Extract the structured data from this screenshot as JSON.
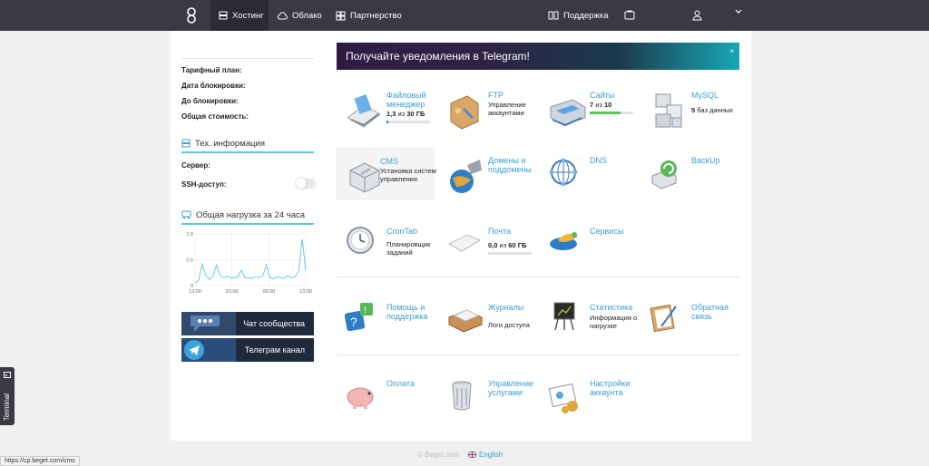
{
  "nav": {
    "hosting": "Хостинг",
    "cloud": "Облако",
    "partner": "Партнерство",
    "support": "Поддержка"
  },
  "sidebar": {
    "plan_label": "Тарифный план:",
    "block_date_label": "Дата блокировки:",
    "until_block_label": "До блокировки:",
    "total_cost_label": "Общая стоимость:",
    "tech_title": "Тех. информация",
    "server_label": "Сервер:",
    "ssh_label": "SSH-доступ:",
    "load_title": "Общая нагрузка за 24 часа",
    "chat_label": "Чат сообщества",
    "telegram_label": "Телеграм канал"
  },
  "chart_data": {
    "type": "line",
    "title": "Общая нагрузка за 24 часа",
    "x_ticks": [
      "13:00",
      "21:00",
      "05:00",
      "13:00"
    ],
    "y_ticks": [
      "1.0",
      "0.5",
      "0"
    ],
    "ylim": [
      0,
      1
    ],
    "series": [
      {
        "values": [
          0.05,
          0.1,
          0.42,
          0.2,
          0.12,
          0.18,
          0.4,
          0.2,
          0.15,
          0.18,
          0.15,
          0.15,
          0.17,
          0.3,
          0.15,
          0.15,
          0.14,
          0.17,
          0.15,
          0.2,
          0.4,
          0.15,
          0.13,
          0.17,
          0.15,
          0.14,
          0.2,
          0.15,
          0.17,
          0.28,
          0.9,
          0.3
        ],
        "color": "#6cc5ea"
      }
    ]
  },
  "banner": {
    "text": "Получайте уведомления в Telegram!",
    "close": "×"
  },
  "tiles": {
    "files": {
      "name": "Файловый менеджер",
      "used": "1,3",
      "of": "из",
      "total": "30 ГБ",
      "fill": 0.04
    },
    "ftp": {
      "name": "FTP",
      "sub": "Управление аккаунтами"
    },
    "sites": {
      "name": "Сайты",
      "used": "7",
      "of": "из",
      "total": "10",
      "fill": 0.7
    },
    "mysql": {
      "name": "MySQL",
      "count": "5",
      "sub": "баз данных"
    },
    "cms": {
      "name": "CMS",
      "sub": "Установка систем управления"
    },
    "domains": {
      "name": "Домены и поддомены"
    },
    "dns": {
      "name": "DNS"
    },
    "backup": {
      "name": "BackUp"
    },
    "crontab": {
      "name": "CronTab",
      "sub": "Планировщик заданий"
    },
    "mail": {
      "name": "Почта",
      "used": "0,0",
      "of": "из",
      "total": "60 ГБ",
      "fill": 0.0
    },
    "services": {
      "name": "Сервисы"
    },
    "help": {
      "name": "Помощь и поддержка"
    },
    "logs": {
      "name": "Журналы",
      "sub": "Логи доступа"
    },
    "stats": {
      "name": "Статистика",
      "sub": "Информация о нагрузке"
    },
    "feedback": {
      "name": "Обратная связь"
    },
    "payment": {
      "name": "Оплата"
    },
    "manage": {
      "name": "Управление услугами"
    },
    "account": {
      "name": "Настройки аккаунта"
    }
  },
  "footer": {
    "copyright": "© Beget.com",
    "language": "English"
  },
  "status_url": "https://cp.beget.com/cms",
  "terminal_label": "Terminal"
}
